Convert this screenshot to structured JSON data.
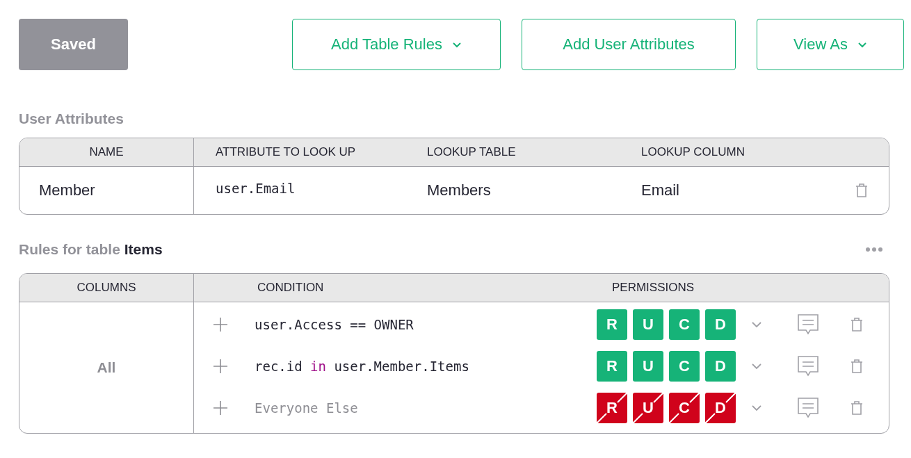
{
  "toolbar": {
    "save_button": {
      "label": "Saved",
      "disabled": true
    },
    "buttons": [
      {
        "label": "Add Table Rules",
        "dropdown": true
      },
      {
        "label": "Add User Attributes",
        "dropdown": false
      },
      {
        "label": "View As",
        "dropdown": true
      }
    ]
  },
  "user_attributes": {
    "title": "User Attributes",
    "columns": [
      "NAME",
      "ATTRIBUTE TO LOOK UP",
      "LOOKUP TABLE",
      "LOOKUP COLUMN"
    ],
    "rows": [
      {
        "name": "Member",
        "attribute": "user.Email",
        "lookup_table": "Members",
        "lookup_column": "Email"
      }
    ]
  },
  "rules": {
    "title_prefix": "Rules for table",
    "table_name": "Items",
    "columns": [
      "COLUMNS",
      "CONDITION",
      "PERMISSIONS"
    ],
    "column_set": "All",
    "rows": [
      {
        "kind": "condition",
        "condition": [
          {
            "text": "user.Access == OWNER",
            "kind": "plain"
          }
        ],
        "permissions": [
          {
            "letter": "R",
            "allowed": true
          },
          {
            "letter": "U",
            "allowed": true
          },
          {
            "letter": "C",
            "allowed": true
          },
          {
            "letter": "D",
            "allowed": true
          }
        ]
      },
      {
        "kind": "condition",
        "condition": [
          {
            "text": "rec.id ",
            "kind": "plain"
          },
          {
            "text": "in",
            "kind": "keyword"
          },
          {
            "text": " user.Member.Items",
            "kind": "plain"
          }
        ],
        "permissions": [
          {
            "letter": "R",
            "allowed": true
          },
          {
            "letter": "U",
            "allowed": true
          },
          {
            "letter": "C",
            "allowed": true
          },
          {
            "letter": "D",
            "allowed": true
          }
        ]
      },
      {
        "kind": "default",
        "condition": [
          {
            "text": "Everyone Else",
            "kind": "plain"
          }
        ],
        "permissions": [
          {
            "letter": "R",
            "allowed": false
          },
          {
            "letter": "U",
            "allowed": false
          },
          {
            "letter": "C",
            "allowed": false
          },
          {
            "letter": "D",
            "allowed": false
          }
        ]
      }
    ]
  }
}
